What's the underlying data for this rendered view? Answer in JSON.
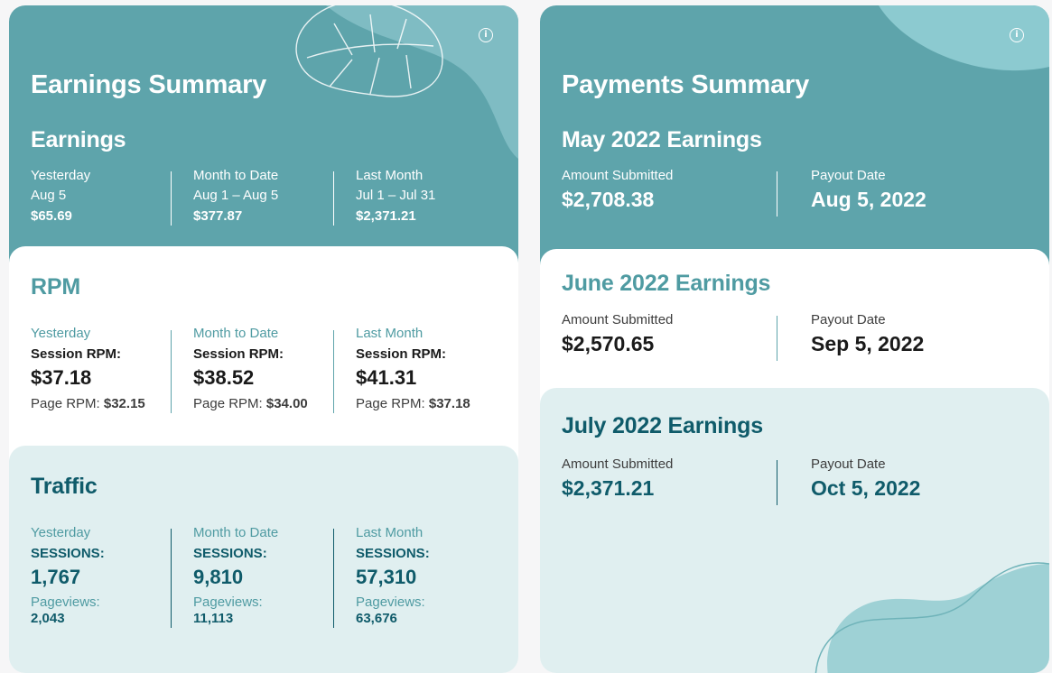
{
  "earnings": {
    "title": "Earnings Summary",
    "earnings_section": {
      "title": "Earnings",
      "columns": [
        {
          "period": "Yesterday",
          "range": "Aug 5",
          "value": "$65.69"
        },
        {
          "period": "Month to Date",
          "range": "Aug 1 – Aug 5",
          "value": "$377.87"
        },
        {
          "period": "Last Month",
          "range": "Jul 1 – Jul 31",
          "value": "$2,371.21"
        }
      ]
    },
    "rpm_section": {
      "title": "RPM",
      "session_label": "Session RPM:",
      "page_label": "Page RPM:",
      "columns": [
        {
          "period": "Yesterday",
          "session_rpm": "$37.18",
          "page_rpm": "$32.15"
        },
        {
          "period": "Month to Date",
          "session_rpm": "$38.52",
          "page_rpm": "$34.00"
        },
        {
          "period": "Last Month",
          "session_rpm": "$41.31",
          "page_rpm": "$37.18"
        }
      ]
    },
    "traffic_section": {
      "title": "Traffic",
      "sessions_label": "SESSIONS:",
      "pageviews_label": "Pageviews:",
      "columns": [
        {
          "period": "Yesterday",
          "sessions": "1,767",
          "pageviews": "2,043"
        },
        {
          "period": "Month to Date",
          "sessions": "9,810",
          "pageviews": "11,113"
        },
        {
          "period": "Last Month",
          "sessions": "57,310",
          "pageviews": "63,676"
        }
      ]
    }
  },
  "payments": {
    "title": "Payments Summary",
    "amount_label": "Amount Submitted",
    "payout_label": "Payout Date",
    "months": [
      {
        "title": "May 2022 Earnings",
        "amount": "$2,708.38",
        "payout": "Aug 5, 2022"
      },
      {
        "title": "June 2022 Earnings",
        "amount": "$2,570.65",
        "payout": "Sep 5, 2022"
      },
      {
        "title": "July 2022 Earnings",
        "amount": "$2,371.21",
        "payout": "Oct 5, 2022"
      }
    ]
  },
  "colors": {
    "teal": "#5ea4ab",
    "light_teal": "#e0eff0",
    "navy": "#0f5b6a",
    "accent_text": "#4f9ba2"
  },
  "icons": [
    "info-icon",
    "monstera-leaf-decoration",
    "blob-decoration"
  ]
}
